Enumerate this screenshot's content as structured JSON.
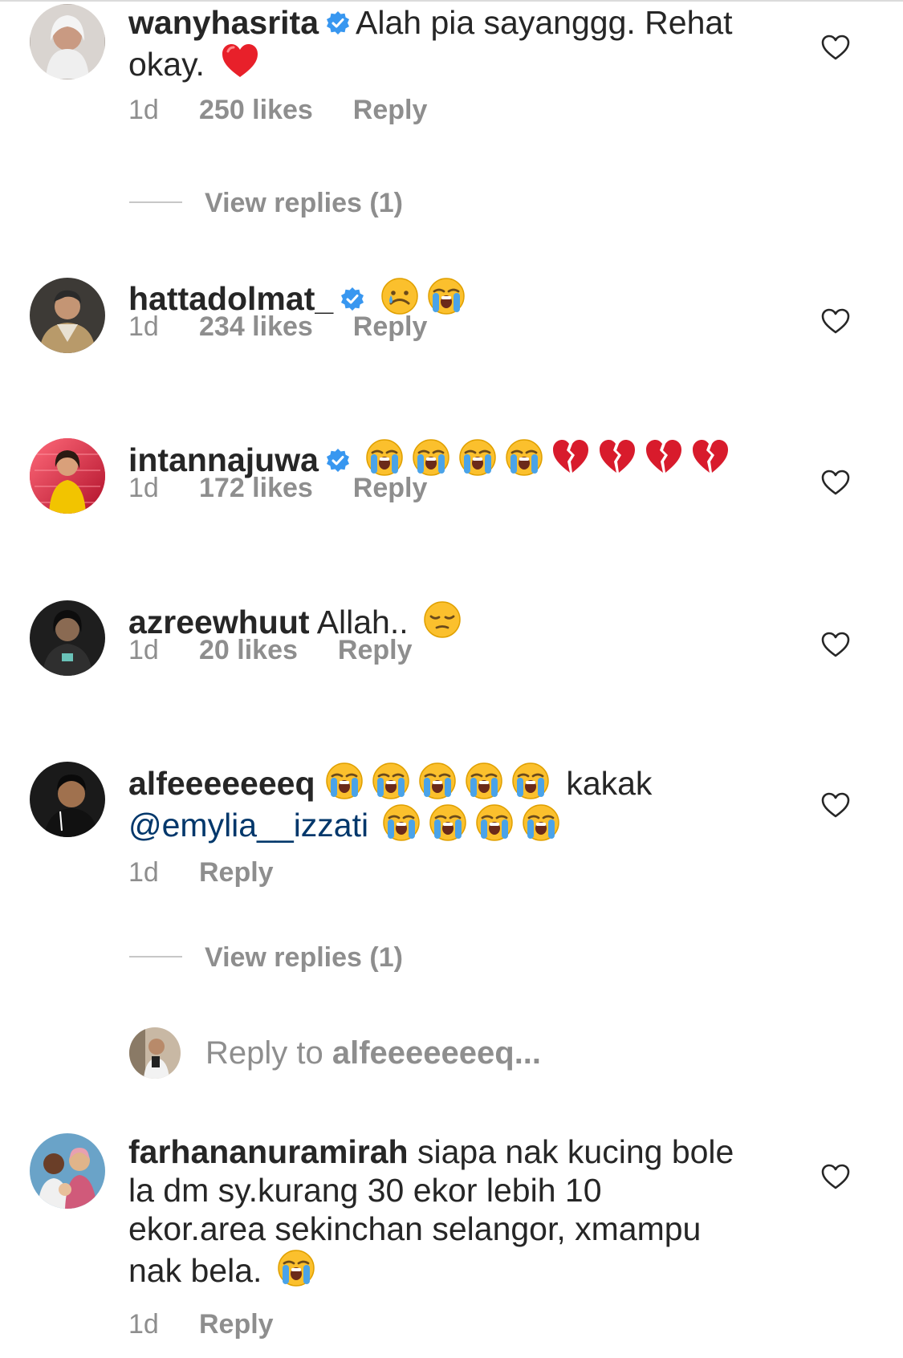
{
  "comments": [
    {
      "username": "wanyhasrita",
      "verified": true,
      "text_line1": "Alah pia sayanggg. Rehat",
      "text_line2": "okay.",
      "time": "1d",
      "likes": "250 likes",
      "reply": "Reply",
      "emoji": [
        "red-heart"
      ]
    },
    {
      "username": "hattadolmat_",
      "verified": true,
      "time": "1d",
      "likes": "234 likes",
      "reply": "Reply",
      "emoji": [
        "crying-face",
        "loudly-crying-face"
      ]
    },
    {
      "username": "intannajuwa",
      "verified": true,
      "time": "1d",
      "likes": "172 likes",
      "reply": "Reply",
      "emoji": [
        "loudly-crying-face",
        "loudly-crying-face",
        "loudly-crying-face",
        "loudly-crying-face",
        "broken-heart",
        "broken-heart",
        "broken-heart",
        "broken-heart"
      ]
    },
    {
      "username": "azreewhuut",
      "verified": false,
      "text": "Allah..",
      "time": "1d",
      "likes": "20 likes",
      "reply": "Reply",
      "emoji": [
        "pensive-face"
      ]
    },
    {
      "username": "alfeeeeeeeq",
      "verified": false,
      "text": "kakak",
      "mention": "@emylia__izzati",
      "time": "1d",
      "reply": "Reply",
      "emoji": [
        "loudly-crying-face",
        "loudly-crying-face",
        "loudly-crying-face",
        "loudly-crying-face",
        "loudly-crying-face",
        "loudly-crying-face",
        "loudly-crying-face",
        "loudly-crying-face",
        "loudly-crying-face"
      ]
    },
    {
      "username": "farhananuramirah",
      "verified": false,
      "text_line1": "siapa nak kucing bole",
      "text_line2": "la dm sy.kurang 30 ekor lebih 10",
      "text_line3": "ekor.area sekinchan selangor, xmampu",
      "text_line4": "nak bela.",
      "time": "1d",
      "reply": "Reply",
      "emoji": [
        "loudly-crying-face"
      ]
    }
  ],
  "view_replies": [
    "View replies (1)",
    "View replies (1)"
  ],
  "reply_to": {
    "prefix": "Reply to ",
    "target": "alfeeeeeeeq..."
  },
  "icons": {
    "like": "heart-outline-icon",
    "verified": "verified-badge-icon"
  },
  "colors": {
    "text": "#262626",
    "secondary": "#8e8e8e",
    "verified": "#3897f0",
    "mention": "#00376b"
  }
}
